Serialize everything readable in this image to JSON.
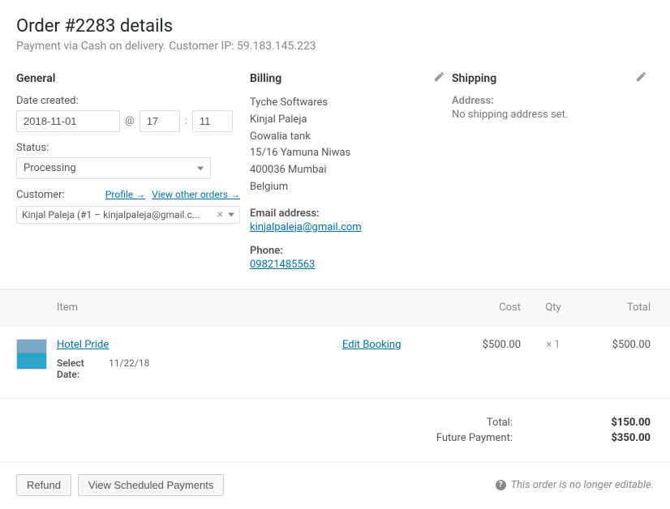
{
  "header": {
    "title": "Order #2283 details",
    "subtitle": "Payment via Cash on delivery. Customer IP: 59.183.145.223"
  },
  "general": {
    "heading": "General",
    "date_label": "Date created:",
    "date_value": "2018-11-01",
    "at_symbol": "@",
    "hour_value": "17",
    "colon": ":",
    "minute_value": "11",
    "status_label": "Status:",
    "status_value": "Processing",
    "customer_label": "Customer:",
    "profile_link": "Profile →",
    "other_orders_link": "View other orders →",
    "customer_value": "Kinjal Paleja (#1 – kinjalpaleja@gmail.c..."
  },
  "billing": {
    "heading": "Billing",
    "lines": [
      "Tyche Softwares",
      "Kinjal Paleja",
      "Gowalia tank",
      "15/16 Yamuna Niwas",
      "400036 Mumbai",
      "Belgium"
    ],
    "email_label": "Email address:",
    "email_value": "kinjalpaleja@gmail.com",
    "phone_label": "Phone:",
    "phone_value": "09821485563"
  },
  "shipping": {
    "heading": "Shipping",
    "address_label": "Address:",
    "no_address": "No shipping address set."
  },
  "items": {
    "head_item": "Item",
    "head_cost": "Cost",
    "head_qty": "Qty",
    "head_total": "Total",
    "row": {
      "name": "Hotel Pride",
      "edit_link": "Edit Booking",
      "meta_key": "Select Date:",
      "meta_val": "11/22/18",
      "cost": "$500.00",
      "qty": "× 1",
      "total": "$500.00"
    }
  },
  "totals": {
    "total_label": "Total:",
    "total_value": "$150.00",
    "future_label": "Future Payment:",
    "future_value": "$350.00"
  },
  "footer": {
    "refund": "Refund",
    "view_scheduled": "View Scheduled Payments",
    "note": "This order is no longer editable."
  }
}
